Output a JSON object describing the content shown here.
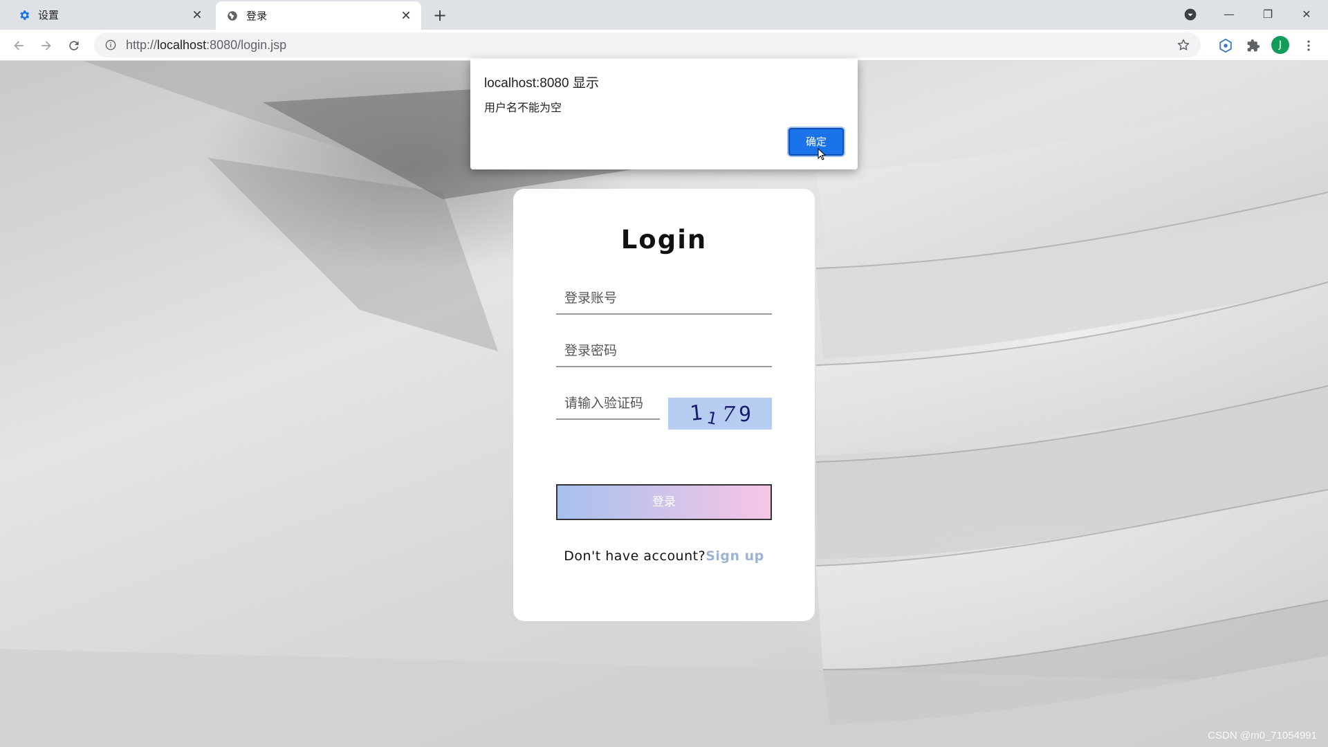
{
  "tabs": [
    {
      "title": "设置",
      "icon": "gear-icon",
      "active": false
    },
    {
      "title": "登录",
      "icon": "globe-icon",
      "active": true
    }
  ],
  "tab_close_glyph": "✕",
  "new_tab_glyph": "+",
  "window_controls": {
    "minimize": "—",
    "restore": "❐",
    "close": "✕"
  },
  "address_bar": {
    "url_prefix": "http://",
    "url_host": "localhost",
    "url_rest": ":8080/login.jsp"
  },
  "profile": {
    "initial": "J",
    "color": "#0f9d58"
  },
  "alert": {
    "title": "localhost:8080 显示",
    "message": "用户名不能为空",
    "ok_label": "确定"
  },
  "login": {
    "title": "Login",
    "username_placeholder": "登录账号",
    "password_placeholder": "登录密码",
    "captcha_placeholder": "请输入验证码",
    "captcha_text": "1179",
    "submit_label": "登录",
    "signup_prompt": "Don't have account?",
    "signup_link": "Sign up"
  },
  "watermark": "CSDN @m0_71054991",
  "colors": {
    "accent": "#1a73e8",
    "button_gradient_start": "#a6c1ee",
    "button_gradient_end": "#f7c5e6",
    "signup_link": "#9ab3d6",
    "captcha_bg": "#b6cdf1"
  }
}
